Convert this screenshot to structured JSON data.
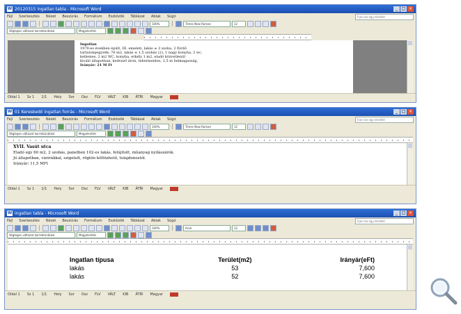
{
  "windows": [
    {
      "title": "20120315 ingatlan tabla - Microsoft Word",
      "menus": [
        "Fájl",
        "Szerkesztés",
        "Nézet",
        "Beszúrás",
        "Formátum",
        "Eszközök",
        "Táblázat",
        "Ablak",
        "Súgó"
      ],
      "help_placeholder": "Írjon be egy kérdést",
      "style_select": "Times New Roman",
      "size_select": "12",
      "zoom_select": "100%",
      "tracking_select": "Végleges változat korrektúrákkal",
      "show_select": "Megjelenítés",
      "doc_heading": "Ingatlan",
      "doc_lines": [
        "1970-es években épült, III. emeleti, lakás ± 3 szoba, 2 fürdő",
        "tartalomjegyzék: 76 m2, lakás ± 1,5 szobás (2), 1 nagy konyha, 2 wc,",
        "kellemes, 2 m2 WC, konyha, erkély 1 m2, eladó közvetlenül",
        "kiváló állapotban, kedvező áron, tehermentes, 2,5 m belmagasság,",
        "Irányár: 21 M Ft"
      ],
      "status": [
        "Oldal 1",
        "Sz 1",
        "1/1",
        "Hely",
        "Sor",
        "Osz",
        "FLV",
        "VÁLT",
        "KIB",
        "ÁTÍR",
        "Magyar"
      ]
    },
    {
      "title": "01 Kereskedő ingatlan forrás - Microsoft Word",
      "menus": [
        "Fájl",
        "Szerkesztés",
        "Nézet",
        "Beszúrás",
        "Formátum",
        "Eszközök",
        "Táblázat",
        "Ablak",
        "Súgó"
      ],
      "help_placeholder": "Írjon be egy kérdést",
      "style_select": "Times New Roman",
      "size_select": "12",
      "zoom_select": "100%",
      "tracking_select": "Végleges változat korrektúrákkal",
      "show_select": "Megjelenítés",
      "doc_heading": "XVII. Vasút utca",
      "doc_lines": [
        "Eladó egy 60 m2, 2 szobás, panelben 102-es lakás, felújított, műanyag nyílászárók.",
        "Jó állapotban, vízórákkal, szigetelt, rögtön költözhető, tulajdonostól.",
        "",
        "Irányár: 11,5 MFt"
      ],
      "status": [
        "Oldal 1",
        "Sz 1",
        "1/1",
        "Hely",
        "Sor",
        "Osz",
        "FLV",
        "VÁLT",
        "KIB",
        "ÁTÍR",
        "Magyar"
      ]
    },
    {
      "title": "ingatlan tabla - Microsoft Word",
      "menus": [
        "Fájl",
        "Szerkesztés",
        "Nézet",
        "Beszúrás",
        "Formátum",
        "Eszközök",
        "Táblázat",
        "Ablak",
        "Súgó"
      ],
      "help_placeholder": "Írjon be egy kérdést",
      "style_select": "Arial",
      "size_select": "12",
      "zoom_select": "100%",
      "tracking_select": "Végleges változat korrektúrákkal",
      "show_select": "Megjelenítés",
      "table_headers": [
        "Ingatlan típusa",
        "Terület(m2)",
        "Irányár(eFt)"
      ],
      "table_rows": [
        [
          "lakás",
          "53",
          "7,600"
        ],
        [
          "lakás",
          "52",
          "7,600"
        ]
      ],
      "status": [
        "Oldal 1",
        "Sz 1",
        "1/1",
        "Hely",
        "Sor",
        "Osz",
        "FLV",
        "VÁLT",
        "KIB",
        "ÁTÍR",
        "Magyar"
      ]
    }
  ],
  "icons": {
    "zoom": "magnifier-icon",
    "app": "word-icon"
  }
}
